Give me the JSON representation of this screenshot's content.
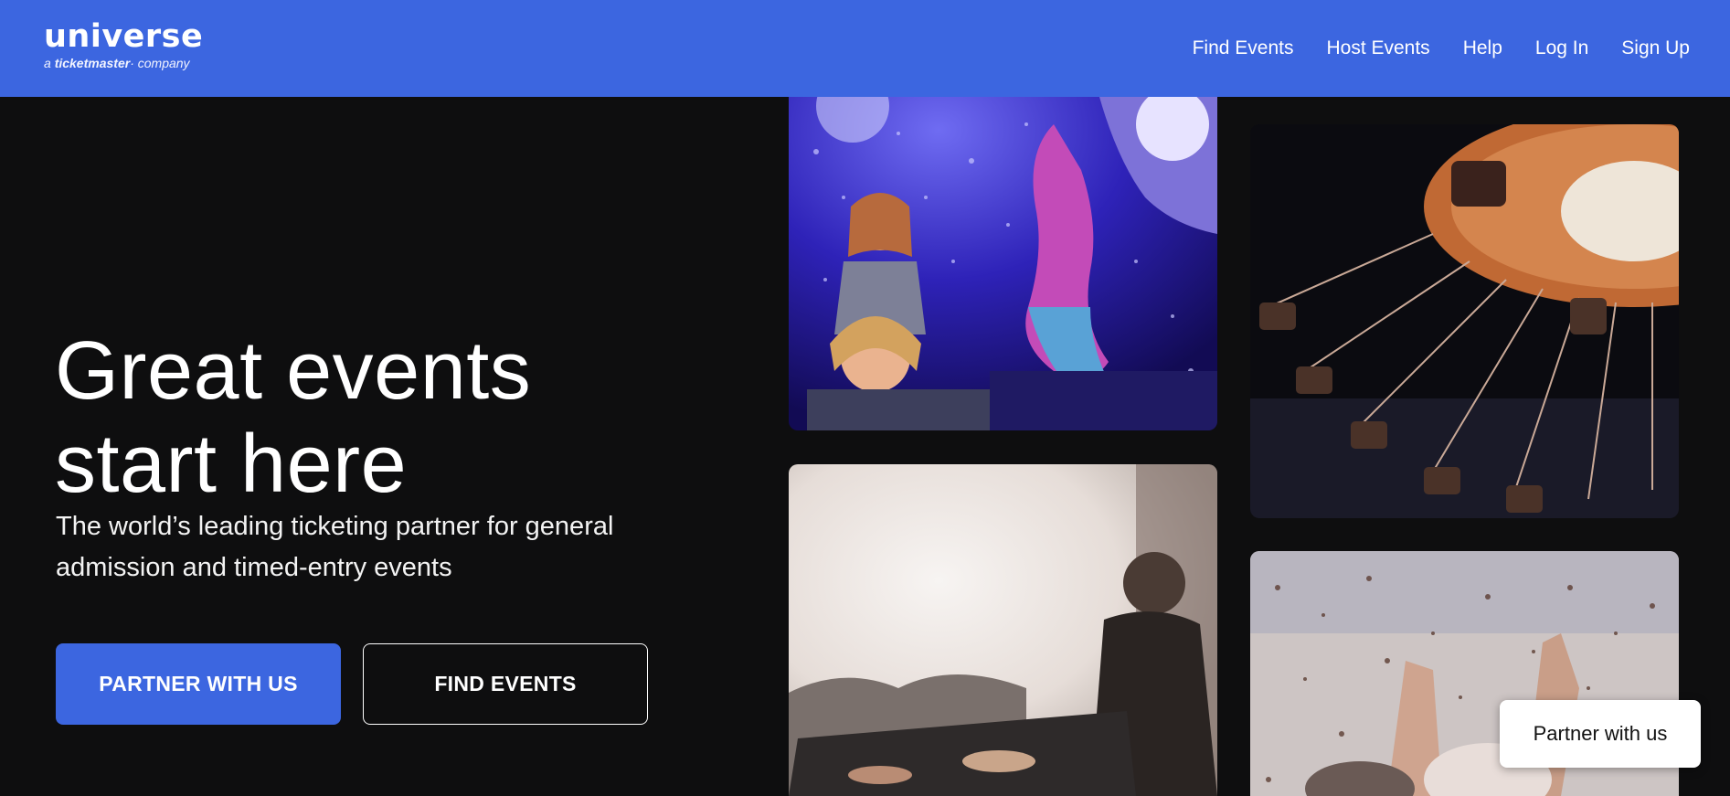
{
  "brand": {
    "name": "universe",
    "tagline_prefix": "a",
    "tagline_brand": "ticketmaster",
    "tagline_suffix": "company",
    "header_color": "#3c66e0"
  },
  "nav": {
    "items": [
      {
        "label": "Find Events"
      },
      {
        "label": "Host Events"
      },
      {
        "label": "Help"
      },
      {
        "label": "Log In"
      },
      {
        "label": "Sign Up"
      }
    ]
  },
  "hero": {
    "title_line1": "Great events",
    "title_line2": "start here",
    "subtitle": "The world’s leading ticketing partner for general admission and timed-entry events",
    "primary_button": "PARTNER WITH US",
    "secondary_button": "FIND EVENTS"
  },
  "images": [
    {
      "icon": "mermaid-show-photo"
    },
    {
      "icon": "swing-carousel-photo"
    },
    {
      "icon": "dj-concert-photo"
    },
    {
      "icon": "confetti-crowd-photo"
    }
  ],
  "floating_button": {
    "label": "Partner with us"
  }
}
